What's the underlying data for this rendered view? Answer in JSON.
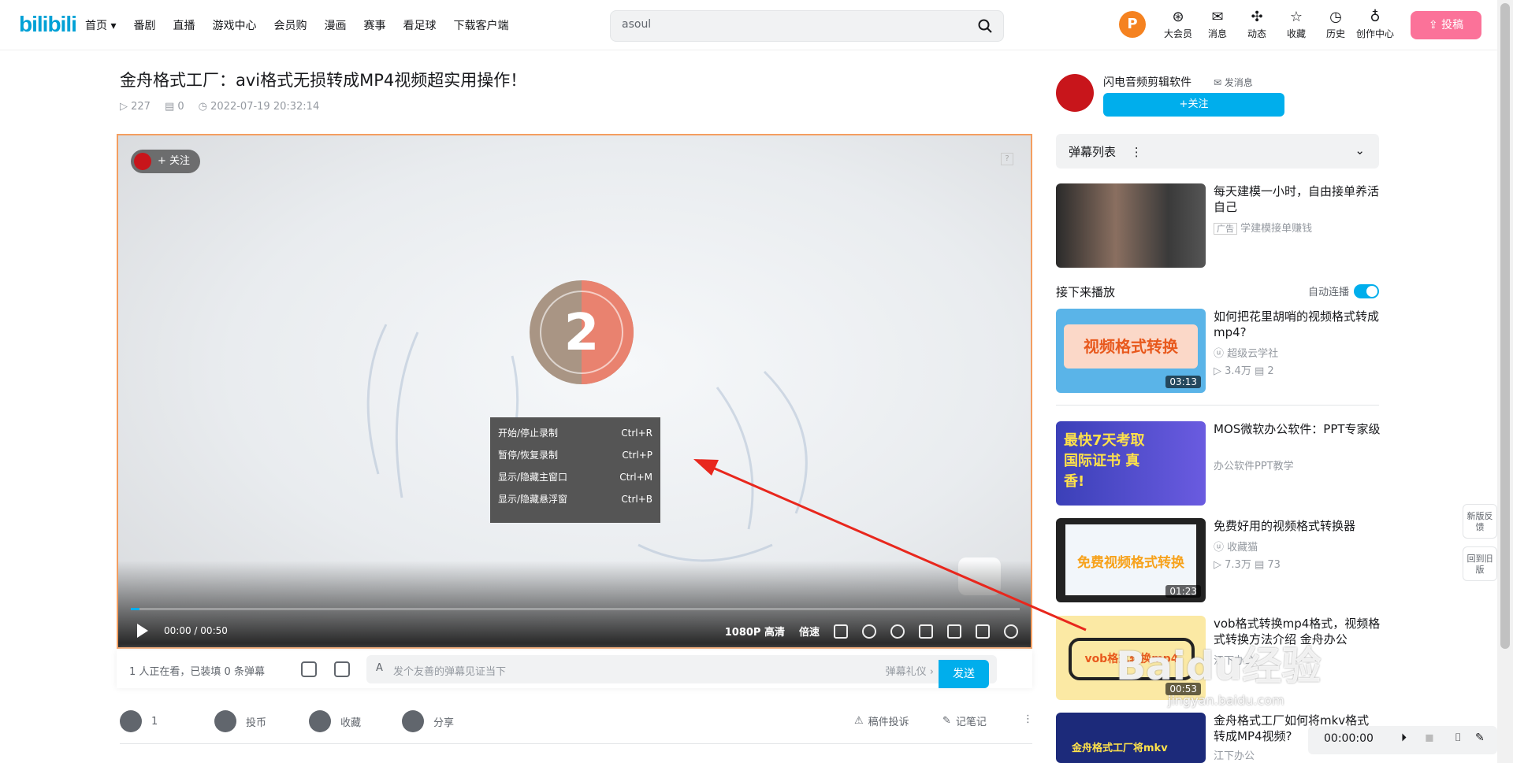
{
  "header": {
    "logo": "bilibili",
    "nav": [
      "首页 ▾",
      "番剧",
      "直播",
      "游戏中心",
      "会员购",
      "漫画",
      "赛事",
      "看足球",
      "下载客户端"
    ],
    "search_value": "asoul",
    "avatar_letter": "P",
    "icons": [
      {
        "label": "大会员",
        "glyph": "⊛"
      },
      {
        "label": "消息",
        "glyph": "✉"
      },
      {
        "label": "动态",
        "glyph": "✣"
      },
      {
        "label": "收藏",
        "glyph": "☆"
      },
      {
        "label": "历史",
        "glyph": "◷"
      },
      {
        "label": "创作中心",
        "glyph": "♁"
      }
    ],
    "upload_label": "⇪ 投稿"
  },
  "video": {
    "title": "金舟格式工厂：avi格式无损转成MP4视频超实用操作！",
    "views": "227",
    "danmaku": "0",
    "date": "2022-07-19 20:32:14",
    "follow_label": "+ 关注",
    "counter": "2",
    "progress": 0.01,
    "time_current": "00:00",
    "time_sep": "/",
    "time_total": "00:50",
    "quality": "1080P 高清",
    "speed": "倍速",
    "context_menu": [
      {
        "label": "开始/停止录制",
        "key": "Ctrl+R"
      },
      {
        "label": "暂停/恢复录制",
        "key": "Ctrl+P"
      },
      {
        "label": "显示/隐藏主窗口",
        "key": "Ctrl+M"
      },
      {
        "label": "显示/隐藏悬浮窗",
        "key": "Ctrl+B"
      }
    ]
  },
  "danmaku_bar": {
    "watching": "1 人正在看，已装填 0 条弹幕",
    "placeholder": "发个友善的弹幕见证当下",
    "gift": "弹幕礼仪 ›",
    "send": "发送"
  },
  "actions": {
    "like": "1",
    "coin": "投币",
    "fav": "收藏",
    "share": "分享",
    "report": "稿件投诉",
    "note": "记笔记"
  },
  "uploader": {
    "name": "闪电音频剪辑软件",
    "message": "✉ 发消息",
    "follow": "+关注"
  },
  "sidebar": {
    "danmaku_list": "弹幕列表",
    "ad": {
      "title": "每天建模一小时，自由接单养活自己",
      "tag": "广告",
      "source": "学建模接单赚钱"
    },
    "next_up": "接下来播放",
    "autoplay": "自动连播",
    "recs": [
      {
        "title": "如何把花里胡哨的视频格式转成mp4?",
        "up": "超级云学社",
        "views": "3.4万",
        "comments": "2",
        "duration": "03:13",
        "thumb_text": "视频格式转换"
      },
      {
        "title": "MOS微软办公软件：PPT专家级",
        "up": "办公软件PPT教学",
        "views": "",
        "comments": "",
        "duration": "",
        "thumb_text": "最快7天考取国际证书 真香!"
      },
      {
        "title": "免费好用的视频格式转换器",
        "up": "收藏猫",
        "views": "7.3万",
        "comments": "73",
        "duration": "01:23",
        "thumb_text": "免费视频格式转换"
      },
      {
        "title": "vob格式转换mp4格式，视频格式转换方法介绍 金舟办公",
        "up": "江下办公",
        "views": "",
        "comments": "",
        "duration": "00:53",
        "thumb_text": "vob格式转换mp4"
      },
      {
        "title": "金舟格式工厂如何将mkv格式转成MP4视频?",
        "up": "江下办公",
        "views": "",
        "comments": "",
        "duration": "",
        "thumb_text": "金舟格式工厂将mkv"
      }
    ]
  },
  "floating": {
    "feedback": "新版反馈",
    "old": "回到旧版"
  },
  "mini_player": {
    "time": "00:00:00"
  },
  "watermark": {
    "text": "Baidu经验",
    "url": "jingyan.baidu.com"
  },
  "colors": {
    "accent": "#00aeec",
    "pink": "#fb7299",
    "arrow": "#e8271d"
  }
}
